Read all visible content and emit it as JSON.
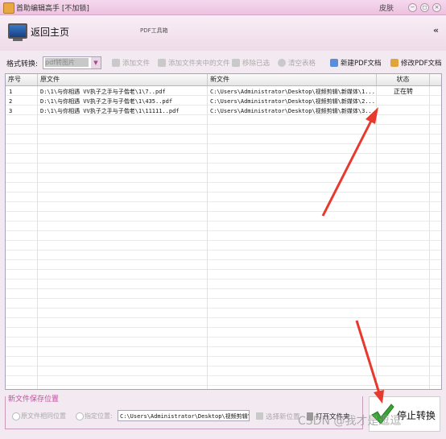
{
  "window": {
    "title": "首助编辑高手 [不加锁]",
    "skin_label": "皮肤",
    "controls": [
      "−",
      "◻",
      "×"
    ]
  },
  "header": {
    "home_label": "返回主页",
    "app_name": "PDF工具箱",
    "collapse_glyph": "«"
  },
  "toolbar": {
    "format_label": "格式转换:",
    "format_value": "pdf转图片",
    "buttons": {
      "add_file": "添加文件",
      "add_folder": "添加文件夹中的文件",
      "remove_selected": "移除已选",
      "clear_list": "清空表格",
      "new_pdf": "新建PDF文档",
      "edit_pdf": "修改PDF文档"
    }
  },
  "table": {
    "columns": [
      "序号",
      "原文件",
      "新文件",
      "状态"
    ],
    "rows": [
      {
        "no": "1",
        "source": "D:\\1\\与你相遇 VV执子之手与子偕老\\1\\7..pdf",
        "target": "C:\\Users\\Administrator\\Desktop\\视频剪辑\\新媒体\\1...",
        "status": "正在转"
      },
      {
        "no": "2",
        "source": "D:\\1\\与你相遇 VV执子之手与子偕老\\1\\435..pdf",
        "target": "C:\\Users\\Administrator\\Desktop\\视频剪辑\\新媒体\\2...",
        "status": ""
      },
      {
        "no": "3",
        "source": "D:\\1\\与你相遇 VV执子之手与子偕老\\1\\11111..pdf",
        "target": "C:\\Users\\Administrator\\Desktop\\视频剪辑\\新媒体\\3...",
        "status": ""
      }
    ]
  },
  "save": {
    "section_title": "新文件保存位置",
    "option_same": "原文件相同位置",
    "option_custom": "指定位置:",
    "path": "C:\\Users\\Administrator\\Desktop\\视频剪辑\\新",
    "choose_label": "选择新位置",
    "open_label": "打开文件夹"
  },
  "action": {
    "stop_label": "停止转换"
  },
  "watermark": "CSDN @我才是逗逗",
  "colors": {
    "accent": "#c44fa4",
    "annotation_arrow": "#e8392e",
    "check_green": "#3aa336"
  }
}
